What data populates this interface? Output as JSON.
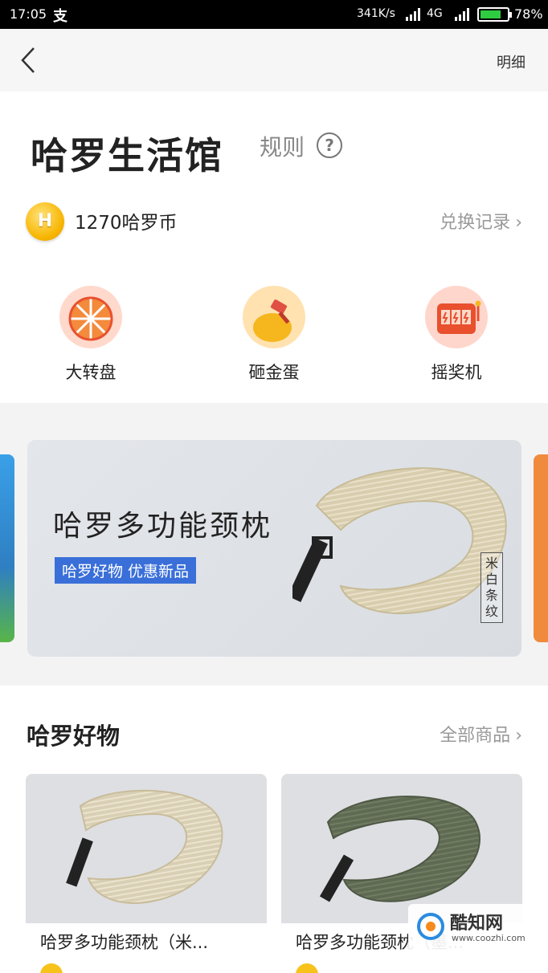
{
  "status_bar": {
    "time": "17:05",
    "alipay_glyph": "支",
    "speed": "341K/s",
    "network": "4G",
    "battery_level": 0.78,
    "battery_percent": "78%"
  },
  "nav": {
    "detail_label": "明细"
  },
  "header": {
    "title": "哈罗生活馆",
    "rules_label": "规则",
    "help_glyph": "?",
    "coin_letter": "H",
    "balance": "1270哈罗币",
    "records_label": "兑换记录"
  },
  "games": [
    {
      "label": "大转盘",
      "icon": "wheel-icon"
    },
    {
      "label": "砸金蛋",
      "icon": "golden-egg-icon"
    },
    {
      "label": "摇奖机",
      "icon": "slot-machine-icon"
    }
  ],
  "banner": {
    "title": "哈罗多功能颈枕",
    "tag": "哈罗好物 优惠新品",
    "variant_label": "米白条纹"
  },
  "products_section": {
    "title": "哈罗好物",
    "all_label": "全部商品",
    "items": [
      {
        "name": "哈罗多功能颈枕（米...",
        "color": "#d9cfb4"
      },
      {
        "name": "哈罗多功能颈枕（墨...",
        "color": "#5f6a52"
      }
    ]
  },
  "watermark": {
    "name": "酷知网",
    "url": "www.coozhi.com"
  },
  "colors": {
    "accent_blue": "#3a6fd9",
    "coin_gold": "#f7b500",
    "muted_text": "#999999"
  }
}
